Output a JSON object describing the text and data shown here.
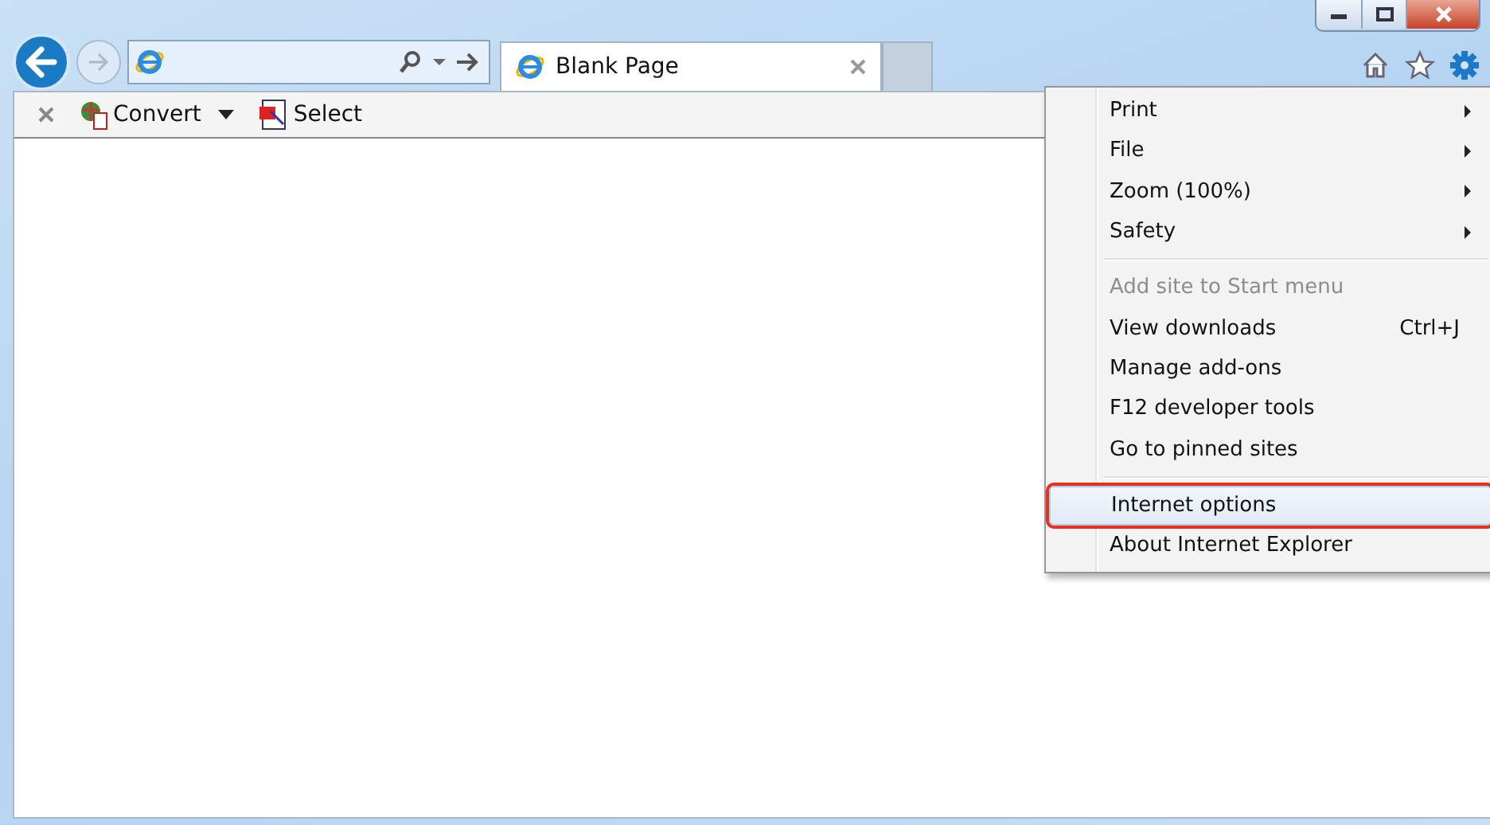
{
  "tab": {
    "title": "Blank Page",
    "selected": true
  },
  "toolbar": {
    "items": [
      {
        "label": "Convert",
        "kind": "dropdown"
      },
      {
        "label": "Select",
        "kind": "button"
      }
    ]
  },
  "menu": {
    "groups": [
      [
        {
          "label": "Print",
          "submenu": true,
          "disabled": false,
          "selected": false
        },
        {
          "label": "File",
          "submenu": true,
          "disabled": false,
          "selected": false
        },
        {
          "label": "Zoom (100%)",
          "submenu": true,
          "disabled": false,
          "selected": false
        },
        {
          "label": "Safety",
          "submenu": true,
          "disabled": false,
          "selected": false
        }
      ],
      [
        {
          "label": "Add site to Start menu",
          "submenu": false,
          "disabled": true,
          "selected": false
        },
        {
          "label": "View downloads",
          "submenu": false,
          "disabled": false,
          "selected": false,
          "shortcut": "Ctrl+J"
        },
        {
          "label": "Manage add-ons",
          "submenu": false,
          "disabled": false,
          "selected": false
        },
        {
          "label": "F12 developer tools",
          "submenu": false,
          "disabled": false,
          "selected": false
        },
        {
          "label": "Go to pinned sites",
          "submenu": false,
          "disabled": false,
          "selected": false
        }
      ],
      [
        {
          "label": "Internet options",
          "submenu": false,
          "disabled": false,
          "selected": true
        },
        {
          "label": "About Internet Explorer",
          "submenu": false,
          "disabled": false,
          "selected": false
        }
      ]
    ]
  }
}
